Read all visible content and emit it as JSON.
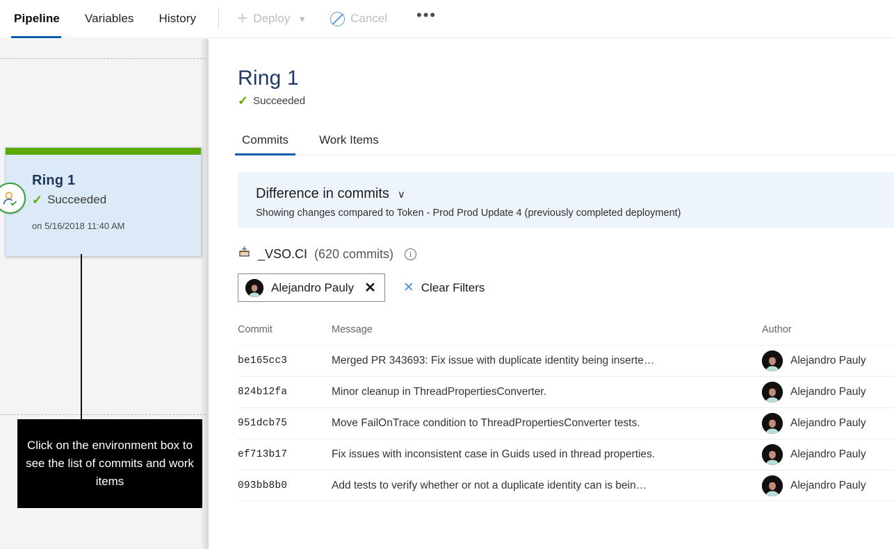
{
  "toolbar": {
    "tabs": [
      {
        "label": "Pipeline",
        "active": true
      },
      {
        "label": "Variables",
        "active": false
      },
      {
        "label": "History",
        "active": false
      }
    ],
    "deploy_label": "Deploy",
    "cancel_label": "Cancel",
    "more_label": "•••"
  },
  "pipeline": {
    "environment": {
      "name": "Ring 1",
      "status": "Succeeded",
      "date": "on 5/16/2018 11:40 AM",
      "status_color": "#5aa800",
      "card_background": "#dce9f7"
    },
    "callout": "Click on the environment box to see the list of commits and work items"
  },
  "details": {
    "title": "Ring 1",
    "status": "Succeeded",
    "tabs": [
      {
        "label": "Commits",
        "active": true
      },
      {
        "label": "Work Items",
        "active": false
      }
    ],
    "banner": {
      "title": "Difference in commits",
      "chevron": "∨",
      "subtitle": "Showing changes compared to Token - Prod Prod Update 4 (previously completed deployment)",
      "background": "#eef4fc"
    },
    "repo": {
      "name": "_VSO.CI",
      "commits_count": "(620 commits)",
      "info_glyph": "i"
    },
    "filters": {
      "chip_name": "Alejandro Pauly",
      "chip_remove": "✕",
      "clear_label": "Clear Filters",
      "clear_x": "✕"
    },
    "table": {
      "columns": [
        "Commit",
        "Message",
        "Author"
      ],
      "rows": [
        {
          "commit": "be165cc3",
          "message": "Merged PR 343693: Fix issue with duplicate identity being inserte…",
          "author": "Alejandro Pauly"
        },
        {
          "commit": "824b12fa",
          "message": "Minor cleanup in ThreadPropertiesConverter.",
          "author": "Alejandro Pauly"
        },
        {
          "commit": "951dcb75",
          "message": "Move FailOnTrace condition to ThreadPropertiesConverter tests.",
          "author": "Alejandro Pauly"
        },
        {
          "commit": "ef713b17",
          "message": "Fix issues with inconsistent case in Guids used in thread properties.",
          "author": "Alejandro Pauly"
        },
        {
          "commit": "093bb8b0",
          "message": "Add tests to verify whether or not a duplicate identity can is bein…",
          "author": "Alejandro Pauly"
        }
      ]
    }
  },
  "colors": {
    "accent_blue": "#0b5cab",
    "success_green": "#5aa800",
    "banner_blue": "#eef4fc",
    "panel_gray": "#f4f4f4"
  }
}
